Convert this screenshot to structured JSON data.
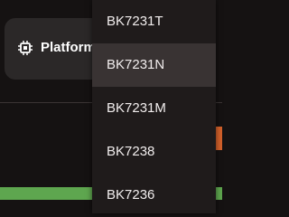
{
  "platform_chip": {
    "label": "Platform",
    "icon": "chip-icon"
  },
  "dropdown": {
    "selected": "BK7231N",
    "items": [
      {
        "label": "BK7231T",
        "selected": false
      },
      {
        "label": "BK7231N",
        "selected": true
      },
      {
        "label": "BK7231M",
        "selected": false
      },
      {
        "label": "BK7238",
        "selected": false
      },
      {
        "label": "BK7236",
        "selected": false
      }
    ]
  },
  "colors": {
    "background": "#151212",
    "chip_background": "#2b2828",
    "menu_background": "#1f1b1b",
    "menu_selected": "#393333",
    "progress_green": "#5ea64f",
    "accent_orange": "#d2602a",
    "text": "#f1eded"
  }
}
